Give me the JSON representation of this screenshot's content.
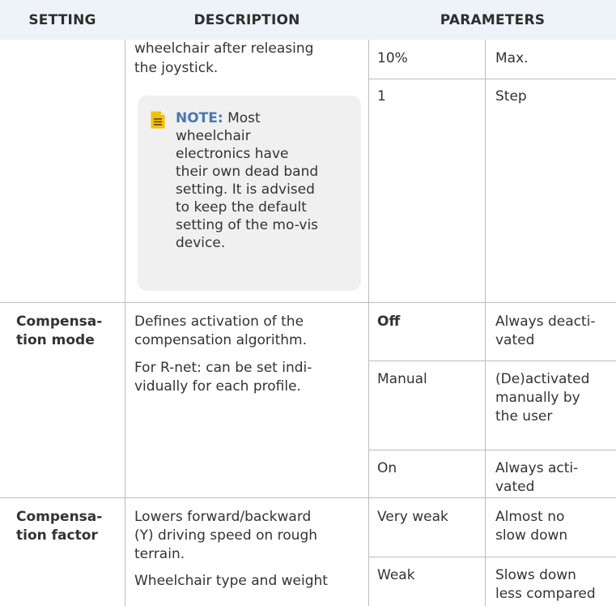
{
  "header": {
    "setting": "SETTING",
    "description": "DESCRIPTION",
    "parameters": "PARAMETERS"
  },
  "dead_band": {
    "description_lines": [
      "wheelchair after releasing",
      "the joystick."
    ],
    "params": [
      {
        "value": "10%",
        "label": "Max."
      },
      {
        "value": "1",
        "label": "Step"
      }
    ],
    "note": {
      "label": "NOTE:",
      "lines": [
        " Most",
        "wheelchair",
        "electronics have",
        "their own dead band",
        "setting. It is advised",
        "to keep the default",
        "setting of the mo-vis",
        "device."
      ]
    }
  },
  "compensation_mode": {
    "setting_lines": [
      "Compensa-",
      "tion mode"
    ],
    "description1_lines": [
      "Defines activation of the",
      "compensation algorithm."
    ],
    "description2_lines": [
      "For R-net: can be set indi-",
      "vidually for each profile."
    ],
    "params": [
      {
        "value": "Off",
        "label_lines": [
          "Always deacti-",
          "vated"
        ]
      },
      {
        "value": "Manual",
        "label_lines": [
          "(De)activated",
          "manually by",
          "the user"
        ]
      },
      {
        "value": "On",
        "label_lines": [
          "Always acti-",
          "vated"
        ]
      }
    ]
  },
  "compensation_factor": {
    "setting_lines": [
      "Compensa-",
      "tion factor"
    ],
    "description1_lines": [
      "Lowers forward/backward",
      "(Y) driving speed on rough",
      "terrain."
    ],
    "description2_lines": [
      "Wheelchair type and weight"
    ],
    "params": [
      {
        "value": "Very weak",
        "label_lines": [
          "Almost no",
          "slow down"
        ]
      },
      {
        "value": "Weak",
        "label_lines": [
          "Slows down",
          "less compared"
        ]
      }
    ]
  },
  "colors": {
    "header_bg": "#edf3f8",
    "rule": "#bdbdbd",
    "note_bg": "#f0f0f0",
    "note_accent": "#4a78b0",
    "note_icon": "#f2c200"
  }
}
